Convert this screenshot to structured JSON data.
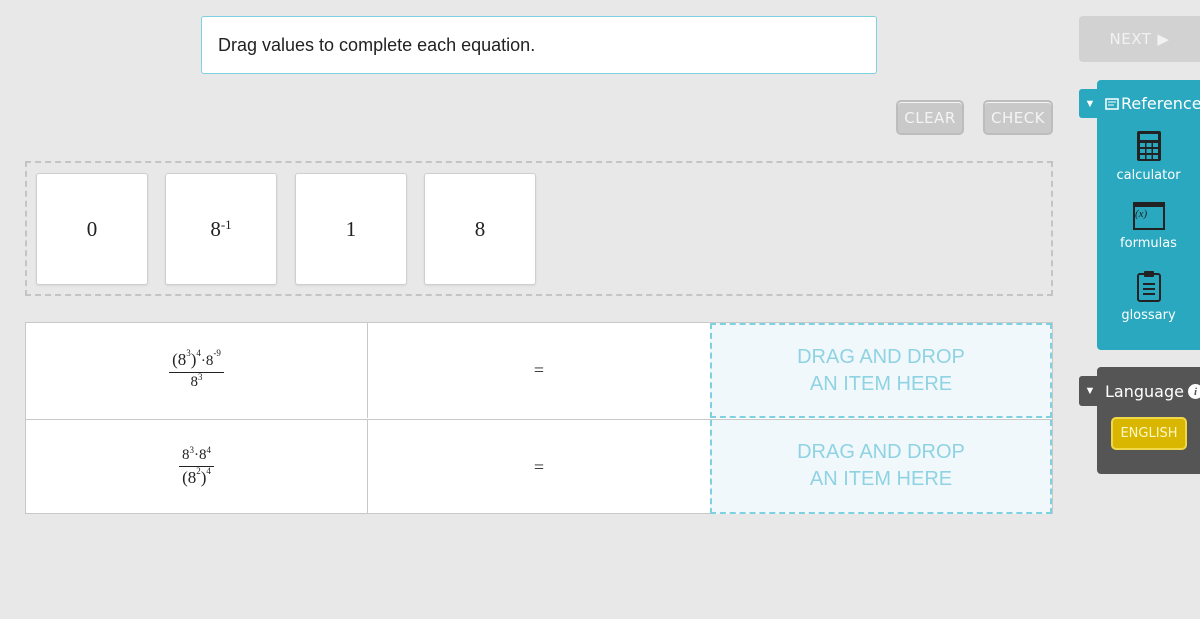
{
  "prompt": "Drag values to complete each equation.",
  "toolbar": {
    "next_label": "NEXT",
    "clear_label": "CLEAR",
    "check_label": "CHECK"
  },
  "tiles": [
    {
      "base": "0",
      "exp": ""
    },
    {
      "base": "8",
      "exp": "-1"
    },
    {
      "base": "1",
      "exp": ""
    },
    {
      "base": "8",
      "exp": ""
    }
  ],
  "equations": [
    {
      "num_a": "(8",
      "num_a_exp": "3",
      "num_b": ")",
      "num_b_exp": "4",
      "num_c": "·8",
      "num_c_exp": "-9",
      "den": "8",
      "den_exp": "3",
      "sign": "=",
      "drop_line1": "DRAG AND DROP",
      "drop_line2": "AN ITEM HERE"
    },
    {
      "num_a": "8",
      "num_a_exp": "3",
      "num_b": "·8",
      "num_b_exp": "4",
      "den_a": "(8",
      "den_a_exp": "2",
      "den_b": ")",
      "den_b_exp": "4",
      "sign": "=",
      "drop_line1": "DRAG AND DROP",
      "drop_line2": "AN ITEM HERE"
    }
  ],
  "reference": {
    "title": "Reference",
    "items": [
      "calculator",
      "formulas",
      "glossary"
    ],
    "formulas_glyph": "(x)"
  },
  "language": {
    "title": "Language",
    "selected": "ENGLISH"
  },
  "colors": {
    "accent": "#2aa8bf",
    "dropzone_border": "#7fd0e0",
    "language_button": "#d9b700"
  }
}
